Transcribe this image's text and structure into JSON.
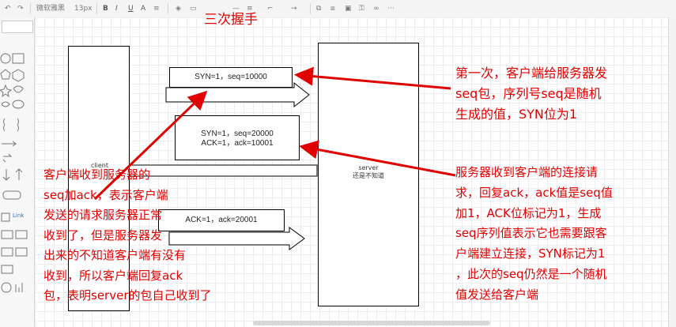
{
  "title": "三次握手",
  "client_label": "client",
  "server": {
    "label": "server",
    "sublabel": "还是不知道"
  },
  "messages": {
    "msg1": "SYN=1，seq=10000",
    "msg2_line1": "SYN=1，seq=20000",
    "msg2_line2": "ACK=1，ack=10001",
    "msg3": "ACK=1，ack=20001"
  },
  "notes": {
    "first": [
      "第一次，客户端给服务器发",
      "seq包，序列号seq是随机",
      "生成的值，SYN位为1"
    ],
    "second": [
      "服务器收到客户端的连接请",
      "求，回复ack，ack值是seq值",
      "加1，ACK位标记为1，生成",
      "seq序列值表示它也需要跟客",
      "户端建立连接，SYN标记为1",
      "，此次的seq仍然是一个随机",
      "值发送给客户端"
    ],
    "third": [
      "客户端收到服务器的",
      "seq加ack，表示客户端",
      "发送的请求服务器正常",
      "收到了，但是服务器发",
      "出来的不知道客户端有没有",
      "收到，所以客户端回复ack",
      "包，表明server的包自己收到了"
    ]
  },
  "toolbar": {
    "font_name": "微软雅黑",
    "font_size": "13px"
  },
  "sidebar": {
    "link_label": "Link"
  },
  "colors": {
    "annotation": "#e00000",
    "stroke": "#000000"
  }
}
